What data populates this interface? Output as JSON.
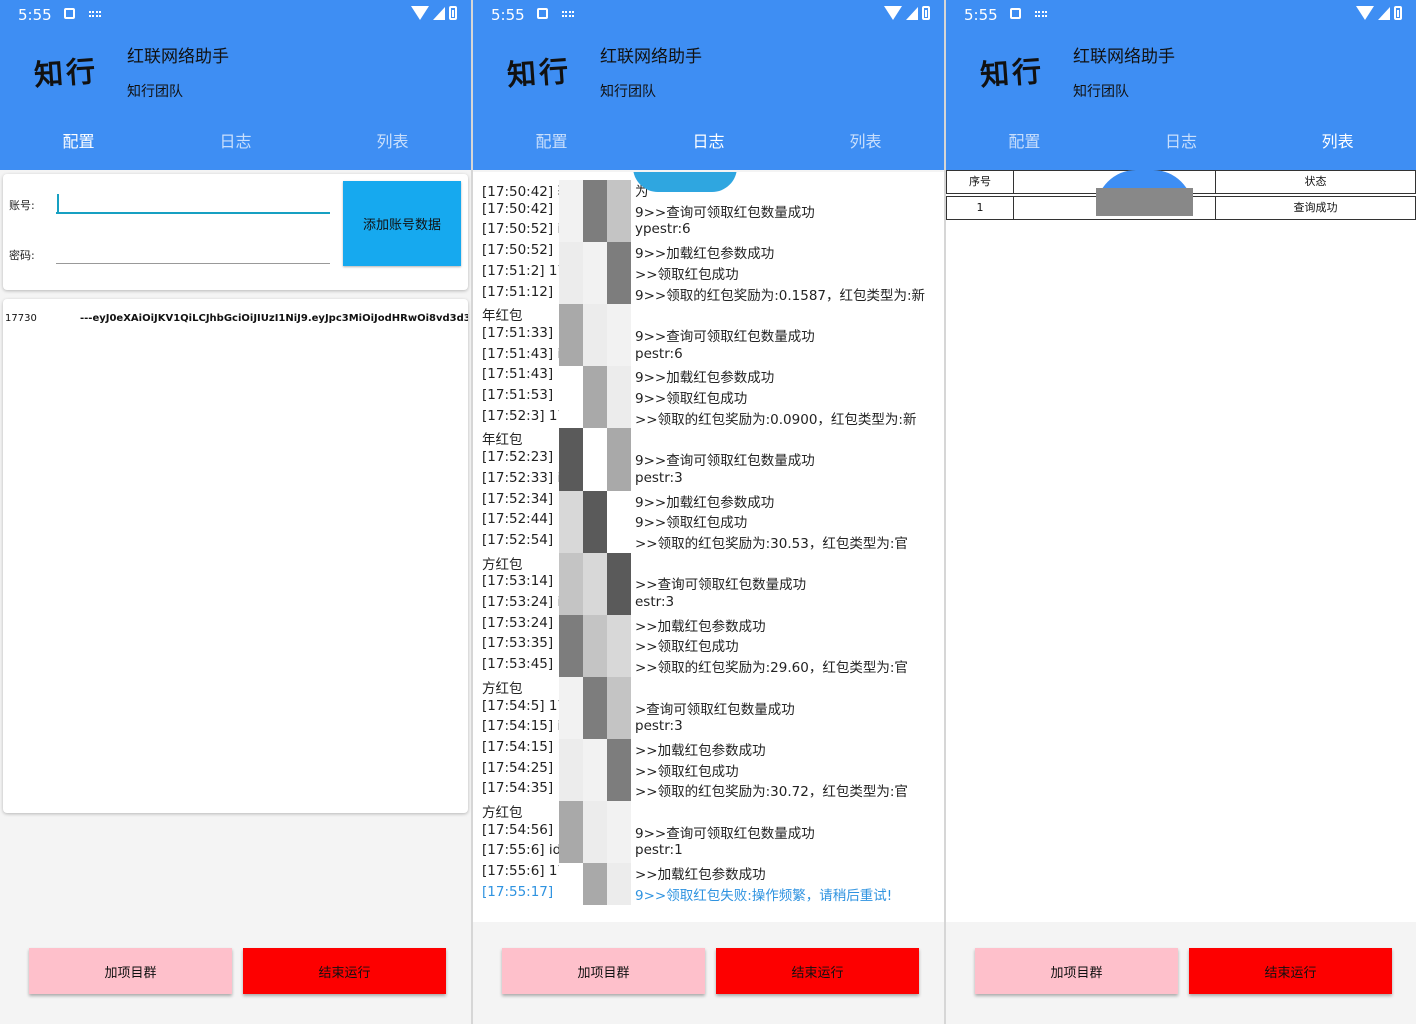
{
  "status_bar": {
    "time": "5:55"
  },
  "header": {
    "logo": "知行",
    "title": "红联网络助手",
    "team": "知行团队"
  },
  "tabs": [
    "配置",
    "日志",
    "列表"
  ],
  "config": {
    "account_label": "账号:",
    "account_value": "",
    "password_label": "密码:",
    "password_value": "",
    "add_button": "添加账号数据",
    "accounts": [
      {
        "id": "17730",
        "token": "---eyJ0eXAiOiJKV1QiLCJhbGciOiJIUzI1NiJ9.eyJpc3MiOiJodHRwOi8vd3d3L"
      }
    ]
  },
  "log": {
    "lines": [
      {
        "left": "[17:50:42] 获",
        "right": "为",
        "type": "normal"
      },
      {
        "left": "[17:50:42] 1",
        "right": "9>>查询可领取红包数量成功",
        "type": "normal"
      },
      {
        "left": "[17:50:52] ic",
        "right": "ypestr:6",
        "type": "normal"
      },
      {
        "left": "[17:50:52] 1",
        "right": "9>>加载红包参数成功",
        "type": "normal"
      },
      {
        "left": "[17:51:2] 17",
        "right": ">>领取红包成功",
        "type": "normal"
      },
      {
        "left": "[17:51:12] 1",
        "right": "9>>领取的红包奖励为:0.1587，红包类型为:新",
        "type": "normal"
      },
      {
        "left": "年红包",
        "right": "",
        "type": "normal"
      },
      {
        "left": "[17:51:33] 1",
        "right": "9>>查询可领取红包数量成功",
        "type": "normal"
      },
      {
        "left": "[17:51:43] ic",
        "right": "pestr:6",
        "type": "normal"
      },
      {
        "left": "[17:51:43] 1",
        "right": "9>>加载红包参数成功",
        "type": "normal"
      },
      {
        "left": "[17:51:53] 1",
        "right": "9>>领取红包成功",
        "type": "normal"
      },
      {
        "left": "[17:52:3] 17",
        "right": ">>领取的红包奖励为:0.0900，红包类型为:新",
        "type": "normal"
      },
      {
        "left": "年红包",
        "right": "",
        "type": "normal"
      },
      {
        "left": "[17:52:23] 1",
        "right": "9>>查询可领取红包数量成功",
        "type": "normal"
      },
      {
        "left": "[17:52:33] ic",
        "right": "pestr:3",
        "type": "normal"
      },
      {
        "left": "[17:52:34] 1",
        "right": "9>>加载红包参数成功",
        "type": "normal"
      },
      {
        "left": "[17:52:44] 1",
        "right": "9>>领取红包成功",
        "type": "normal"
      },
      {
        "left": "[17:52:54] 1",
        "right": ">>领取的红包奖励为:30.53，红包类型为:官",
        "type": "normal"
      },
      {
        "left": "方红包",
        "right": "",
        "type": "normal"
      },
      {
        "left": "[17:53:14] 17",
        "right": ">>查询可领取红包数量成功",
        "type": "normal"
      },
      {
        "left": "[17:53:24] ids",
        "right": "estr:3",
        "type": "normal"
      },
      {
        "left": "[17:53:24] 17",
        "right": ">>加载红包参数成功",
        "type": "normal"
      },
      {
        "left": "[17:53:35] 17",
        "right": ">>领取红包成功",
        "type": "normal"
      },
      {
        "left": "[17:53:45] 17",
        "right": ">>领取的红包奖励为:29.60，红包类型为:官",
        "type": "normal"
      },
      {
        "left": "方红包",
        "right": "",
        "type": "normal"
      },
      {
        "left": "[17:54:5] 177",
        "right": ">查询可领取红包数量成功",
        "type": "normal"
      },
      {
        "left": "[17:54:15] ids",
        "right": "pestr:3",
        "type": "normal"
      },
      {
        "left": "[17:54:15] 17",
        "right": ">>加载红包参数成功",
        "type": "normal"
      },
      {
        "left": "[17:54:25] 17",
        "right": ">>领取红包成功",
        "type": "normal"
      },
      {
        "left": "[17:54:35] 17",
        "right": ">>领取的红包奖励为:30.72，红包类型为:官",
        "type": "normal"
      },
      {
        "left": "方红包",
        "right": "",
        "type": "normal"
      },
      {
        "left": "[17:54:56] 1",
        "right": "9>>查询可领取红包数量成功",
        "type": "normal"
      },
      {
        "left": "[17:55:6] ids",
        "right": "pestr:1",
        "type": "normal"
      },
      {
        "left": "[17:55:6] 17",
        "right": ">>加载红包参数成功",
        "type": "normal"
      },
      {
        "left": "[17:55:17] 1",
        "right": "9>>领取红包失败:操作频繁，请稍后重试!",
        "type": "error"
      }
    ]
  },
  "table": {
    "headers": [
      "序号",
      "",
      "状态"
    ],
    "rows": [
      [
        "1",
        "177",
        "查询成功"
      ]
    ]
  },
  "buttons": {
    "join_group": "加项目群",
    "stop_run": "结束运行"
  },
  "colors": {
    "header_bg": "#3e8ef3",
    "add_button": "#16a9ef",
    "join_button": "#fec0cb",
    "stop_button": "#fd0000",
    "error_text": "#2f93e0"
  }
}
